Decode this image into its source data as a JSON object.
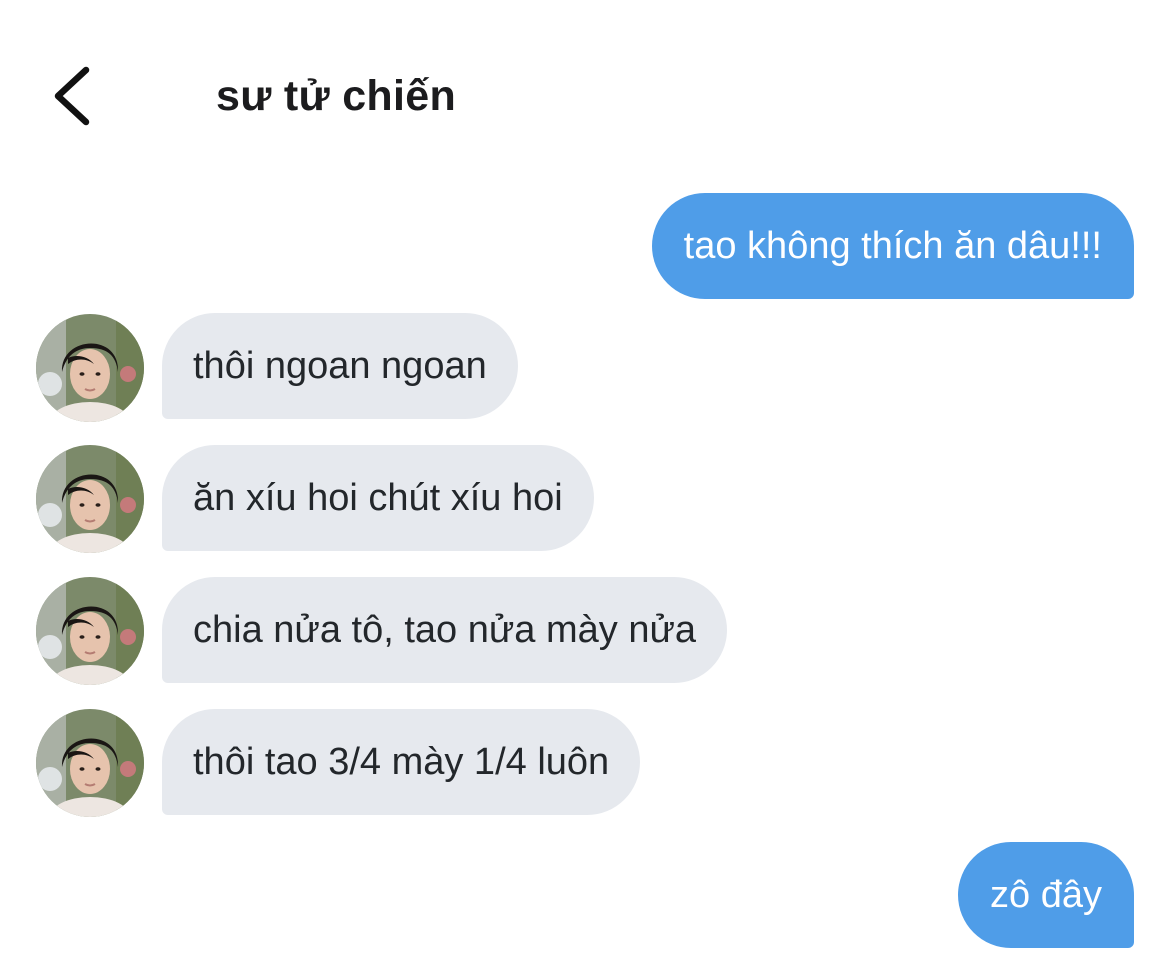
{
  "header": {
    "back_icon": "chevron-left-icon",
    "title": "sư tử chiến"
  },
  "messages": [
    {
      "direction": "out",
      "text": "tao không thích ăn dâu!!!"
    },
    {
      "direction": "in",
      "text": "thôi ngoan ngoan"
    },
    {
      "direction": "in",
      "text": "ăn xíu hoi chút xíu hoi"
    },
    {
      "direction": "in",
      "text": "chia nửa tô, tao nửa mày nửa"
    },
    {
      "direction": "in",
      "text": "thôi tao 3/4 mày 1/4 luôn"
    },
    {
      "direction": "out",
      "text": "zô đây"
    }
  ],
  "colors": {
    "outgoing_bubble": "#4f9de8",
    "incoming_bubble": "#e6e9ee",
    "title_text": "#1c1c1e"
  }
}
